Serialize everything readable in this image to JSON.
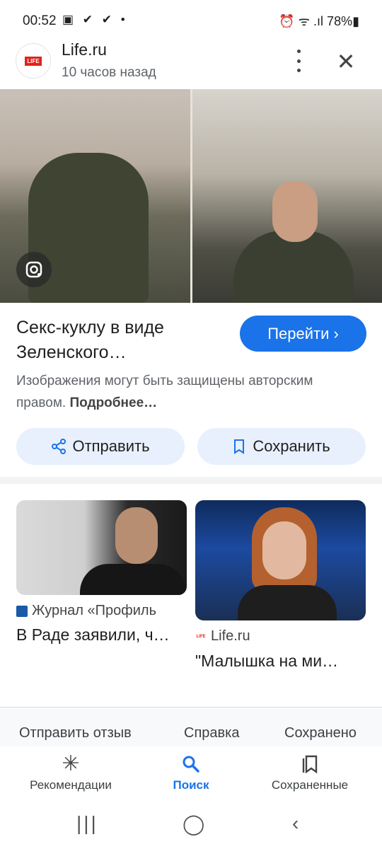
{
  "status_bar": {
    "time": "00:52",
    "icons": "▣ ✔ ✔ •",
    "right": "⏰ ᯤ .ıl 78%▮"
  },
  "header": {
    "logo_text": "LIFE",
    "site_name": "Life.ru",
    "time_ago": "10 часов назад",
    "close_glyph": "✕"
  },
  "result": {
    "title": "Секс-куклу в виде Зеленского…",
    "go_button": "Перейти ›",
    "copyright_text": "Изображения могут быть защищены авторским правом.",
    "copyright_more": "Подробнее…"
  },
  "actions": {
    "send_icon": "⋖",
    "send_label": "Отправить",
    "save_icon": "▯",
    "save_label": "Сохранить"
  },
  "related": [
    {
      "source_icon": "II",
      "source": "Журнал «Профиль",
      "headline": "В Раде заявили, ч…"
    },
    {
      "source_icon": "LIFE",
      "source": "Life.ru",
      "headline": "\"Малышка на ми…"
    }
  ],
  "footer": {
    "feedback": "Отправить отзыв",
    "help": "Справка",
    "saved": "Сохранено"
  },
  "bottom_nav": [
    {
      "icon": "✳",
      "label": "Рекомендации"
    },
    {
      "icon": "⌕",
      "label": "Поиск"
    },
    {
      "icon": "⧉",
      "label": "Сохраненные"
    }
  ],
  "system_nav": {
    "recents": "|||",
    "home": "◯",
    "back": "‹"
  },
  "colors": {
    "accent": "#1a73e8",
    "chip_bg": "#e8f0fe",
    "logo_red": "#e2231a"
  }
}
